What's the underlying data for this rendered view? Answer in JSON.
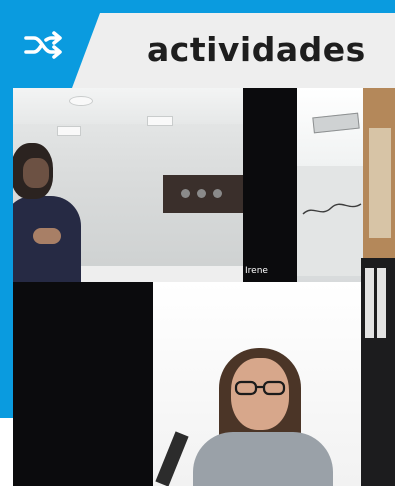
{
  "header": {
    "title": "actividades",
    "icon": "shuffle-icon",
    "accent_color": "#0a9bdf"
  },
  "video_call": {
    "participants": [
      {
        "name": "Irene"
      }
    ]
  }
}
